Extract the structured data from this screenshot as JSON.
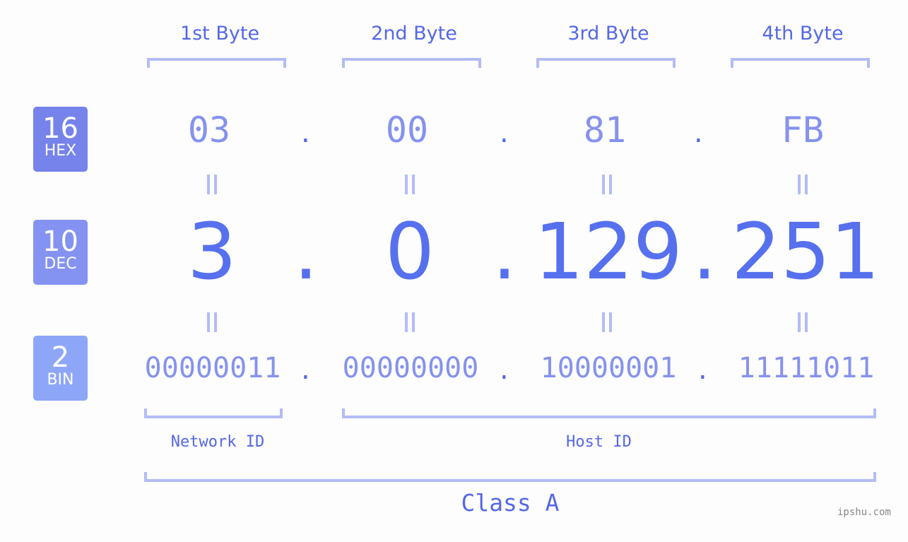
{
  "bytes": [
    {
      "label": "1st Byte",
      "hex": "03",
      "dec": "3",
      "bin": "00000011"
    },
    {
      "label": "2nd Byte",
      "hex": "00",
      "dec": "0",
      "bin": "00000000"
    },
    {
      "label": "3rd Byte",
      "hex": "81",
      "dec": "129",
      "bin": "10000001"
    },
    {
      "label": "4th Byte",
      "hex": "FB",
      "dec": "251",
      "bin": "11111011"
    }
  ],
  "badges": {
    "hex": {
      "num": "16",
      "label": "HEX",
      "color": "#7583ea"
    },
    "dec": {
      "num": "10",
      "label": "DEC",
      "color": "#8493f1"
    },
    "bin": {
      "num": "2",
      "label": "BIN",
      "color": "#8ea6f8"
    }
  },
  "separator": ".",
  "network_label": "Network ID",
  "host_label": "Host ID",
  "class_label": "Class A",
  "watermark": "ipshu.com"
}
